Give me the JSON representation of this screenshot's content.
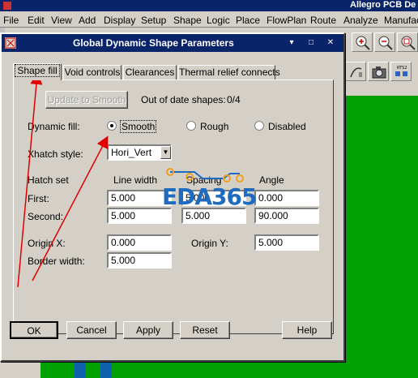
{
  "app": {
    "title": "Allegro PCB De",
    "menu": [
      "File",
      "Edit",
      "View",
      "Add",
      "Display",
      "Setup",
      "Shape",
      "Logic",
      "Place",
      "FlowPlan",
      "Route",
      "Analyze",
      "Manufac"
    ]
  },
  "toolbar": {
    "icons": [
      "zoom-in-icon",
      "zoom-out-icon",
      "zoom-fit-icon",
      "measure-icon",
      "camera-icon",
      "rats-icon"
    ],
    "rats_label": "RTS2"
  },
  "dialog": {
    "title": "Global Dynamic Shape Parameters",
    "tabs": [
      "Shape fill",
      "Void controls",
      "Clearances",
      "Thermal relief connects"
    ],
    "active_tab": "Shape fill",
    "update_button": "Update to Smooth",
    "out_of_date_label": "Out of date shapes:",
    "out_of_date_value": "0/4",
    "dynamic_fill_label": "Dynamic fill:",
    "fill_options": [
      "Smooth",
      "Rough",
      "Disabled"
    ],
    "fill_selected": "Smooth",
    "xhatch_label": "Xhatch style:",
    "xhatch_value": "Hori_Vert",
    "hatch_set_label": "Hatch set",
    "line_width_label": "Line width",
    "spacing_label": "Spacing",
    "angle_label": "Angle",
    "first_label": "First:",
    "second_label": "Second:",
    "first": {
      "line_width": "5.000",
      "spacing": "5.000",
      "angle": "0.000"
    },
    "second": {
      "line_width": "5.000",
      "spacing": "5.000",
      "angle": "90.000"
    },
    "origin_x_label": "Origin X:",
    "origin_x": "0.000",
    "origin_y_label": "Origin Y:",
    "origin_y": "5.000",
    "border_width_label": "Border width:",
    "border_width": "5.000",
    "buttons": {
      "ok": "OK",
      "cancel": "Cancel",
      "apply": "Apply",
      "reset": "Reset",
      "help": "Help"
    }
  },
  "watermark": "EDA365",
  "colors": {
    "title_bar": "#0a246a",
    "canvas_green": "#00a000",
    "annotation_arrow": "#e00000",
    "watermark_blue": "#1f6bbf"
  }
}
